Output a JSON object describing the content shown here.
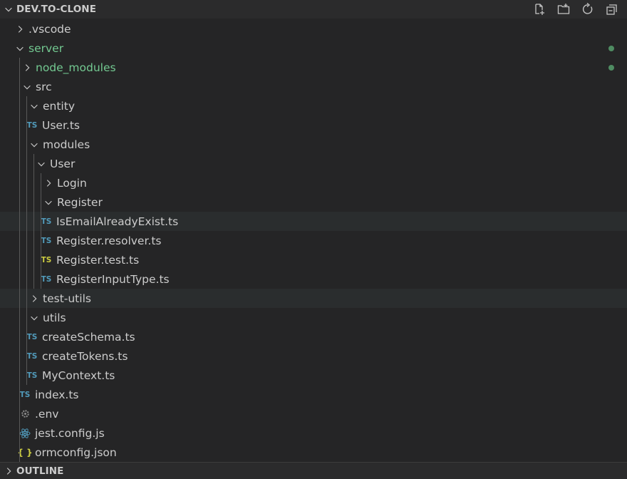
{
  "explorer": {
    "workspace_title": "DEV.TO-CLONE",
    "outline_title": "OUTLINE",
    "actions": [
      {
        "name": "new-file-icon"
      },
      {
        "name": "new-folder-icon"
      },
      {
        "name": "refresh-icon"
      },
      {
        "name": "collapse-all-icon"
      }
    ],
    "tree": [
      {
        "label": ".vscode",
        "depth": 0,
        "kind": "folder",
        "expanded": false
      },
      {
        "label": "server",
        "depth": 0,
        "kind": "folder",
        "expanded": true,
        "git": "untracked"
      },
      {
        "label": "node_modules",
        "depth": 1,
        "kind": "folder",
        "expanded": false,
        "git": "untracked"
      },
      {
        "label": "src",
        "depth": 1,
        "kind": "folder",
        "expanded": true
      },
      {
        "label": "entity",
        "depth": 2,
        "kind": "folder",
        "expanded": true
      },
      {
        "label": "User.ts",
        "depth": 2,
        "kind": "file",
        "icon": "ts"
      },
      {
        "label": "modules",
        "depth": 2,
        "kind": "folder",
        "expanded": true
      },
      {
        "label": "User",
        "depth": 3,
        "kind": "folder",
        "expanded": true
      },
      {
        "label": "Login",
        "depth": 4,
        "kind": "folder",
        "expanded": false
      },
      {
        "label": "Register",
        "depth": 4,
        "kind": "folder",
        "expanded": true
      },
      {
        "label": "IsEmailAlreadyExist.ts",
        "depth": 4,
        "kind": "file",
        "icon": "ts",
        "hover": true
      },
      {
        "label": "Register.resolver.ts",
        "depth": 4,
        "kind": "file",
        "icon": "ts"
      },
      {
        "label": "Register.test.ts",
        "depth": 4,
        "kind": "file",
        "icon": "ts-test"
      },
      {
        "label": "RegisterInputType.ts",
        "depth": 4,
        "kind": "file",
        "icon": "ts"
      },
      {
        "label": "test-utils",
        "depth": 2,
        "kind": "folder",
        "expanded": false,
        "hover": true
      },
      {
        "label": "utils",
        "depth": 2,
        "kind": "folder",
        "expanded": true
      },
      {
        "label": "createSchema.ts",
        "depth": 2,
        "kind": "file",
        "icon": "ts"
      },
      {
        "label": "createTokens.ts",
        "depth": 2,
        "kind": "file",
        "icon": "ts"
      },
      {
        "label": "MyContext.ts",
        "depth": 2,
        "kind": "file",
        "icon": "ts"
      },
      {
        "label": "index.ts",
        "depth": 1,
        "kind": "file",
        "icon": "ts"
      },
      {
        "label": ".env",
        "depth": 1,
        "kind": "file",
        "icon": "gear"
      },
      {
        "label": "jest.config.js",
        "depth": 1,
        "kind": "file",
        "icon": "react"
      },
      {
        "label": "ormconfig.json",
        "depth": 1,
        "kind": "file",
        "icon": "json"
      }
    ],
    "icon_text": {
      "ts": "TS",
      "json": "{ }"
    },
    "colors": {
      "background": "#252526",
      "hover": "#2a2d2e",
      "untracked": "#73c991",
      "ts_icon": "#519aba",
      "ts_test_icon": "#cbcb41",
      "json_icon": "#cbcb41",
      "react_icon": "#519aba",
      "status_dot": "#4f8c62"
    }
  }
}
